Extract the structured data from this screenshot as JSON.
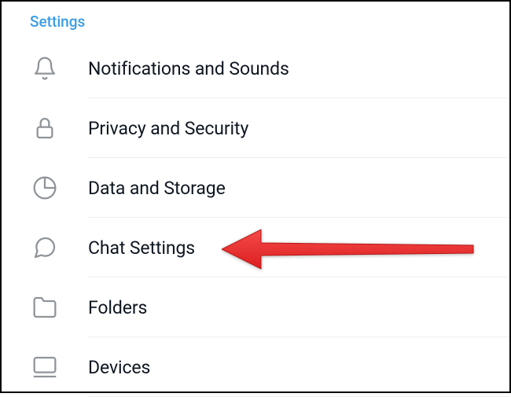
{
  "section": {
    "title": "Settings"
  },
  "items": [
    {
      "label": "Notifications and Sounds",
      "icon": "bell-icon"
    },
    {
      "label": "Privacy and Security",
      "icon": "lock-icon"
    },
    {
      "label": "Data and Storage",
      "icon": "pie-chart-icon"
    },
    {
      "label": "Chat Settings",
      "icon": "chat-bubble-icon"
    },
    {
      "label": "Folders",
      "icon": "folder-icon"
    },
    {
      "label": "Devices",
      "icon": "monitor-icon"
    }
  ],
  "annotation": {
    "type": "arrow",
    "color": "#ed2d30",
    "target": "chat-settings"
  }
}
